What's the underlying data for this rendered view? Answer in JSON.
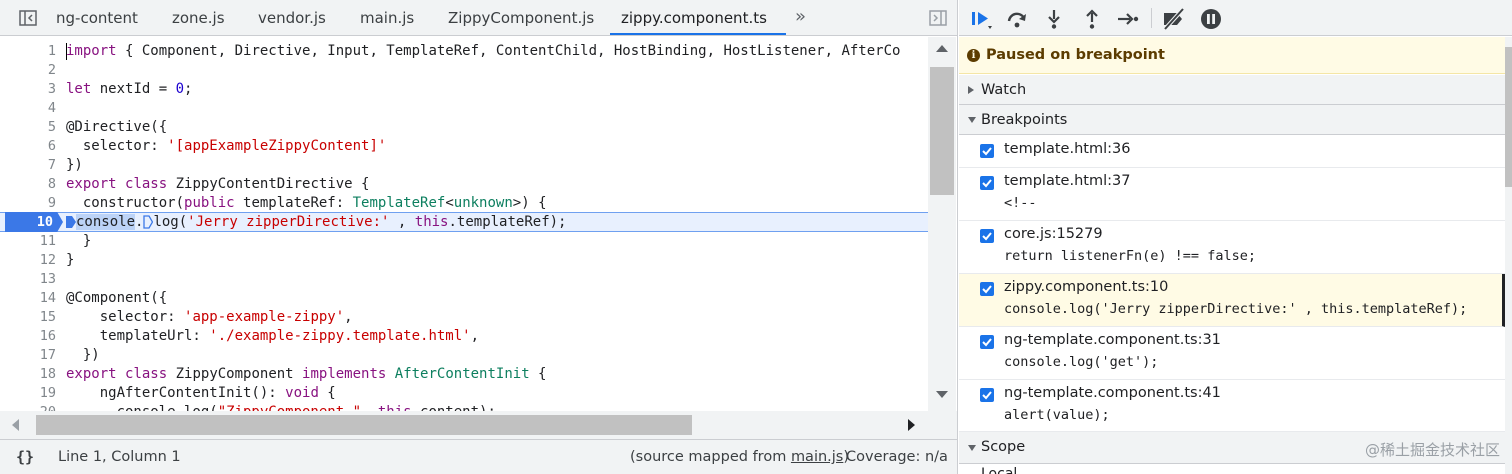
{
  "tabs": [
    "ng-content",
    "zone.js",
    "vendor.js",
    "main.js",
    "ZippyComponent.js",
    "zippy.component.ts"
  ],
  "active_tab": "zippy.component.ts",
  "tabs_overflow": "»",
  "code_lines": [
    {
      "n": "1",
      "text": "import { Component, Directive, Input, TemplateRef, ContentChild, HostBinding, HostListener, AfterCo"
    },
    {
      "n": "2",
      "text": ""
    },
    {
      "n": "3",
      "text": "let nextId = 0;"
    },
    {
      "n": "4",
      "text": ""
    },
    {
      "n": "5",
      "text": "@Directive({"
    },
    {
      "n": "6",
      "text": "  selector: '[appExampleZippyContent]'"
    },
    {
      "n": "7",
      "text": "})"
    },
    {
      "n": "8",
      "text": "export class ZippyContentDirective {"
    },
    {
      "n": "9",
      "text": "  constructor(public templateRef: TemplateRef<unknown>) {"
    },
    {
      "n": "10",
      "text": "    console.log('Jerry zipperDirective:' , this.templateRef);"
    },
    {
      "n": "11",
      "text": "  }"
    },
    {
      "n": "12",
      "text": "}"
    },
    {
      "n": "13",
      "text": ""
    },
    {
      "n": "14",
      "text": "@Component({"
    },
    {
      "n": "15",
      "text": "    selector: 'app-example-zippy',"
    },
    {
      "n": "16",
      "text": "    templateUrl: './example-zippy.template.html',"
    },
    {
      "n": "17",
      "text": "  })"
    },
    {
      "n": "18",
      "text": "export class ZippyComponent implements AfterContentInit {"
    },
    {
      "n": "19",
      "text": "    ngAfterContentInit(): void {"
    },
    {
      "n": "20",
      "text": "      console.log(\"ZippyComponent.\", this.content);"
    }
  ],
  "breakpoint_line": "10",
  "status": {
    "cursor": "Line 1, Column 1",
    "source_mapped_prefix": "(source mapped from ",
    "source_mapped_link": "main.js",
    "source_mapped_suffix": ")",
    "coverage": "Coverage: n/a",
    "braces": "{}"
  },
  "paused_text": "Paused on breakpoint",
  "sections": {
    "watch": "Watch",
    "breakpoints": "Breakpoints",
    "scope": "Scope",
    "local": "Local"
  },
  "breakpoints": [
    {
      "loc": "template.html:36",
      "code": ""
    },
    {
      "loc": "template.html:37",
      "code": "<!--"
    },
    {
      "loc": "core.js:15279",
      "code": "return listenerFn(e) !== false;"
    },
    {
      "loc": "zippy.component.ts:10",
      "code": "console.log('Jerry zipperDirective:' , this.templateRef);"
    },
    {
      "loc": "ng-template.component.ts:31",
      "code": "console.log('get');"
    },
    {
      "loc": "ng-template.component.ts:41",
      "code": "alert(value);"
    }
  ],
  "watermark": "@稀土掘金技术社区",
  "colors": {
    "accent": "#1a73e8",
    "paused_bg": "#fffbe5",
    "breakpoint_marker": "#3b78e7"
  }
}
